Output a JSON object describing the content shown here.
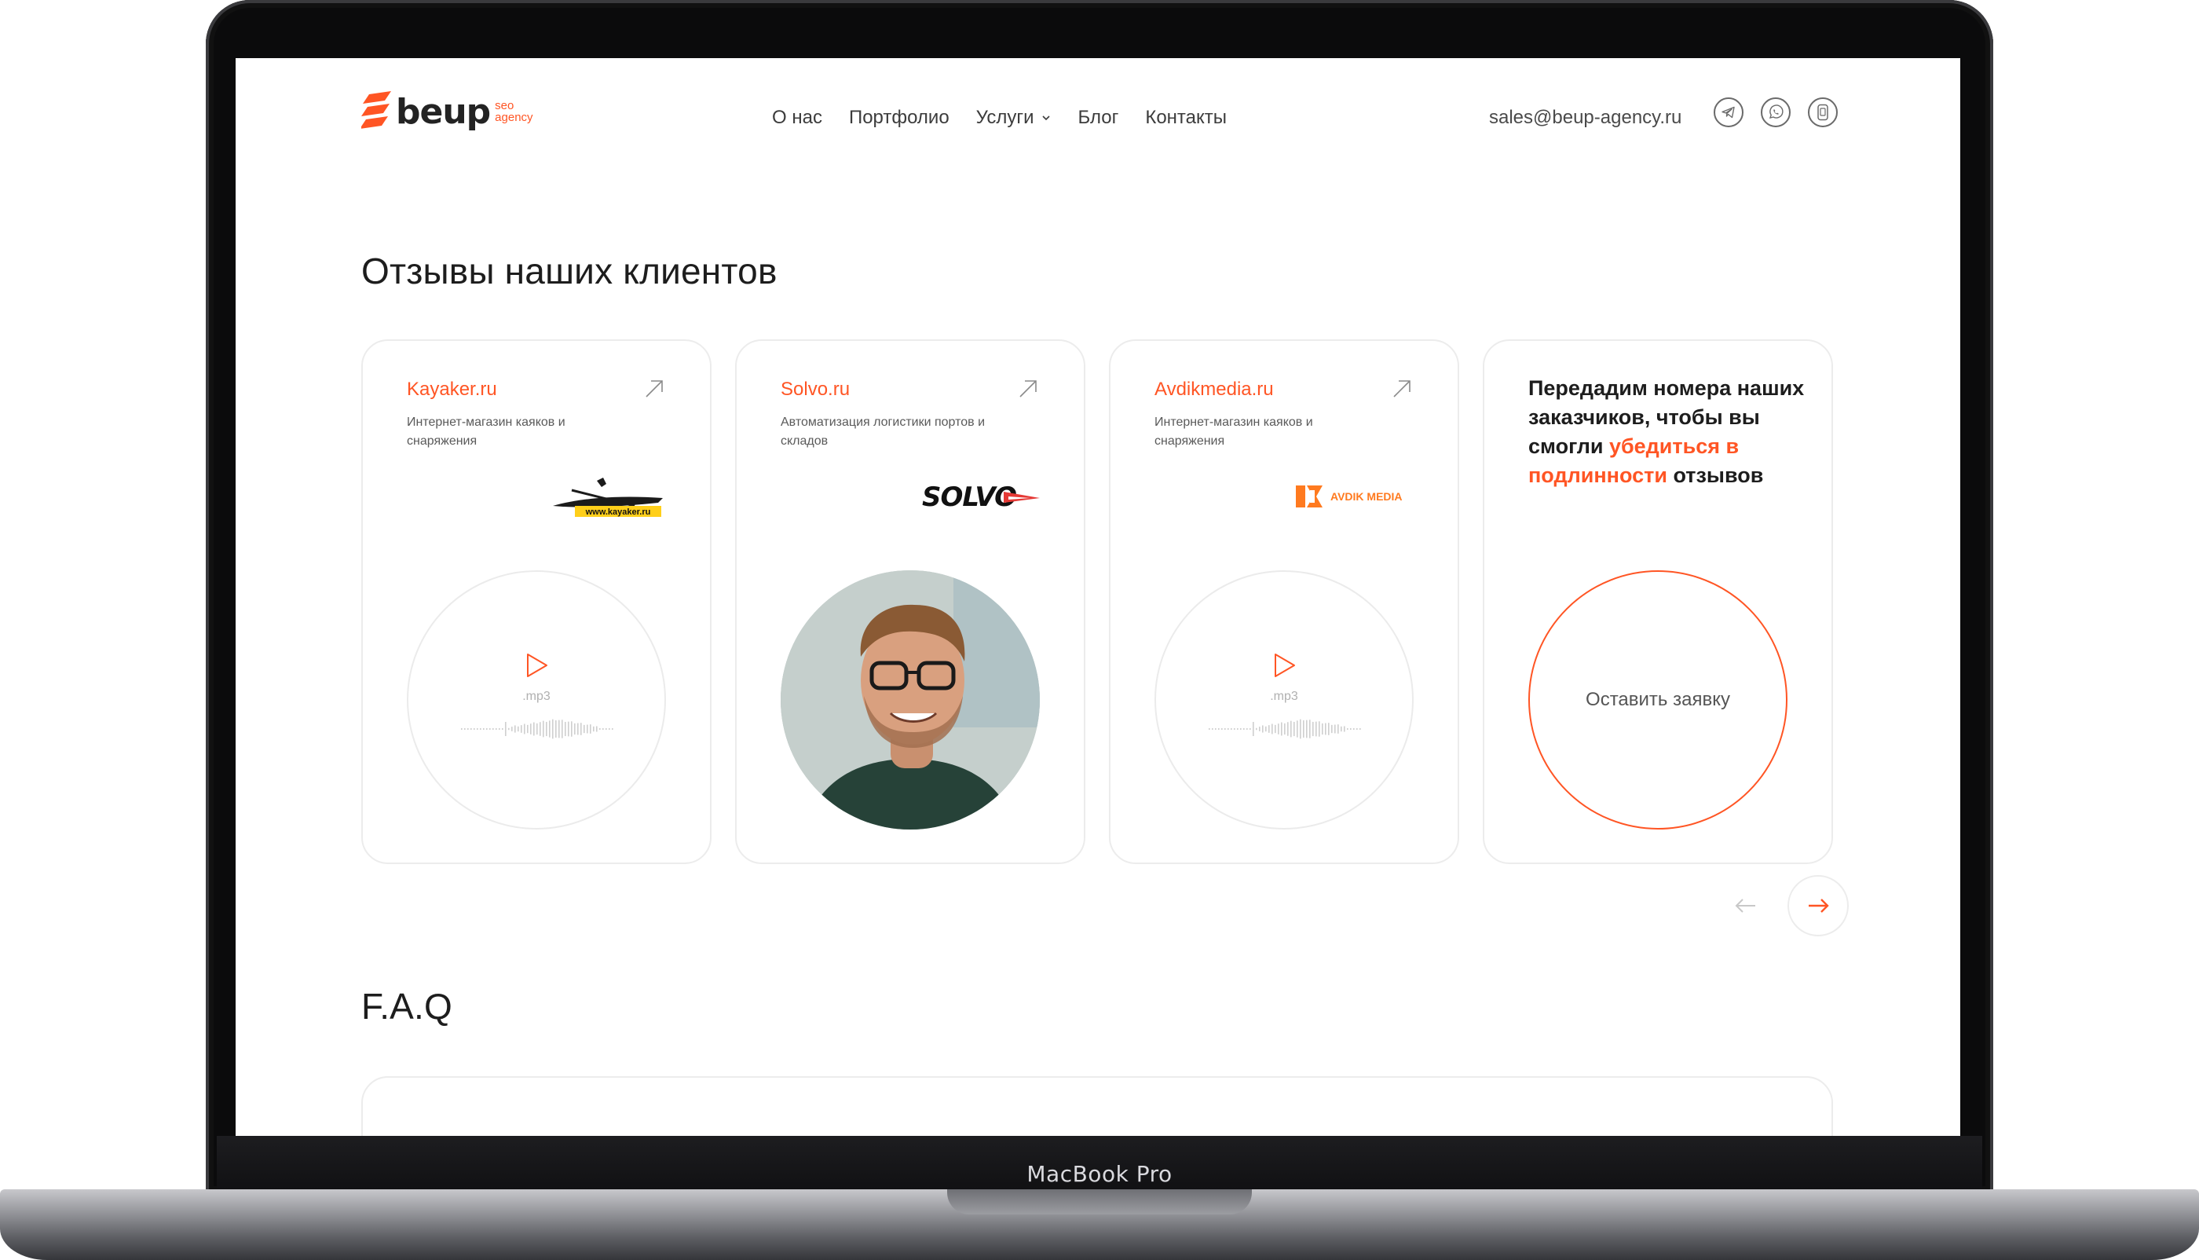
{
  "device": {
    "label": "MacBook Pro"
  },
  "header": {
    "logo": {
      "word": "beup",
      "sub_line1": "seo",
      "sub_line2": "agency"
    },
    "nav": [
      {
        "label": "О нас"
      },
      {
        "label": "Портфолио"
      },
      {
        "label": "Услуги",
        "has_dropdown": true
      },
      {
        "label": "Блог"
      },
      {
        "label": "Контакты"
      }
    ],
    "email": "sales@beup-agency.ru",
    "socials": [
      "telegram-icon",
      "whatsapp-icon",
      "phone-icon"
    ]
  },
  "reviews": {
    "title": "Отзывы наших клиентов",
    "cards": [
      {
        "site": "Kayaker.ru",
        "desc": "Интернет-магазин каяков и снаряжения",
        "logo_text": "www.kayaker.ru",
        "media": "audio",
        "media_label": ".mp3"
      },
      {
        "site": "Solvo.ru",
        "desc": "Автоматизация логистики портов и складов",
        "logo_text": "SOLVO",
        "media": "photo"
      },
      {
        "site": "Avdikmedia.ru",
        "desc": "Интернет-магазин каяков и снаряжения",
        "logo_text": "AVDIK MEDIA",
        "media": "audio",
        "media_label": ".mp3"
      }
    ],
    "cta": {
      "text_before": "Передадим номера наших заказчиков, чтобы вы смогли ",
      "text_accent": "убедиться в подлинности",
      "text_after": " отзывов",
      "button": "Оставить заявку"
    }
  },
  "faq": {
    "title": "F.A.Q"
  },
  "colors": {
    "accent": "#ff5524",
    "text": "#1d1d1d",
    "border": "#ececec"
  }
}
